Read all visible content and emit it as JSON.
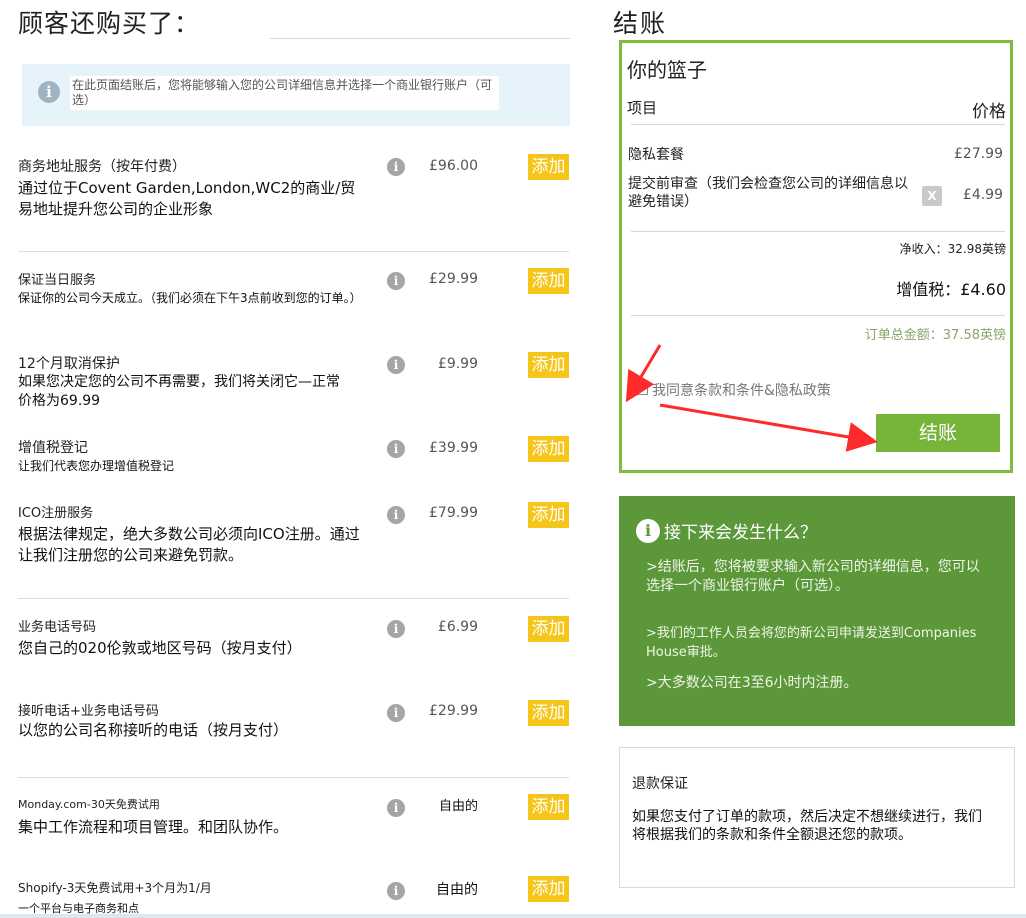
{
  "left": {
    "title": "顾客还购买了：",
    "info_text": "在此页面结账后，您将能够输入您的公司详细信息并选择一个商业银行账户（可选）",
    "add_label": "添加",
    "services": [
      {
        "title": "商务地址服务（按年付费）",
        "desc": "通过位于Covent Garden,London,WC2的商业/贸易地址提升您公司的企业形象",
        "price": "£96.00"
      },
      {
        "title": "保证当日服务",
        "desc": "保证你的公司今天成立。（我们必须在下午3点前收到您的订单。）",
        "price": "£29.99"
      },
      {
        "title": "12个月取消保护",
        "desc": "如果您决定您的公司不再需要，我们将关闭它—正常价格为69.99",
        "price": "£9.99"
      },
      {
        "title": "增值税登记",
        "desc": "让我们代表您办理增值税登记",
        "price": "£39.99"
      },
      {
        "title": "ICO注册服务",
        "desc": "根据法律规定，绝大多数公司必须向ICO注册。通过让我们注册您的公司来避免罚款。",
        "price": "£79.99"
      },
      {
        "title": "业务电话号码",
        "desc": "您自己的020伦敦或地区号码（按月支付）",
        "price": "£6.99"
      },
      {
        "title": "接听电话+业务电话号码",
        "desc": "以您的公司名称接听的电话（按月支付）",
        "price": "£29.99"
      },
      {
        "title": "Monday.com-30天免费试用",
        "desc": "集中工作流程和项目管理。和团队协作。",
        "price": "自由的"
      },
      {
        "title": "Shopify-3天免费试用+3个月为1/月",
        "desc": "一个平台与电子商务和点",
        "price": "自由的"
      }
    ]
  },
  "checkout": {
    "title": "结账",
    "basket_title": "你的篮子",
    "col_item": "项目",
    "col_price": "价格",
    "items": [
      {
        "name": "隐私套餐",
        "price": "£27.99"
      },
      {
        "name": "提交前审查（我们会检查您公司的详细信息以避免错误）",
        "price": "£4.99",
        "remove": "X"
      }
    ],
    "net": "净收入：32.98英镑",
    "vat": "增值税：£4.60",
    "total": "订单总金额：37.58英镑",
    "terms": "我同意条款和条件&隐私政策",
    "button": "结账"
  },
  "next": {
    "title": "接下来会发生什么？",
    "p1": ">结账后，您将被要求输入新公司的详细信息，您可以选择一个商业银行账户（可选）。",
    "p2": ">我们的工作人员会将您的新公司申请发送到Companies House审批。",
    "p3": ">大多数公司在3至6小时内注册。"
  },
  "refund": {
    "title": "退款保证",
    "text": "如果您支付了订单的款项，然后决定不想继续进行，我们将根据我们的条款和条件全额退还您的款项。"
  },
  "colors": {
    "accent_green": "#76b43a",
    "add_yellow": "#f6c51a",
    "info_blue": "#e6f3fb",
    "arrow_red": "#ff2a2a"
  }
}
